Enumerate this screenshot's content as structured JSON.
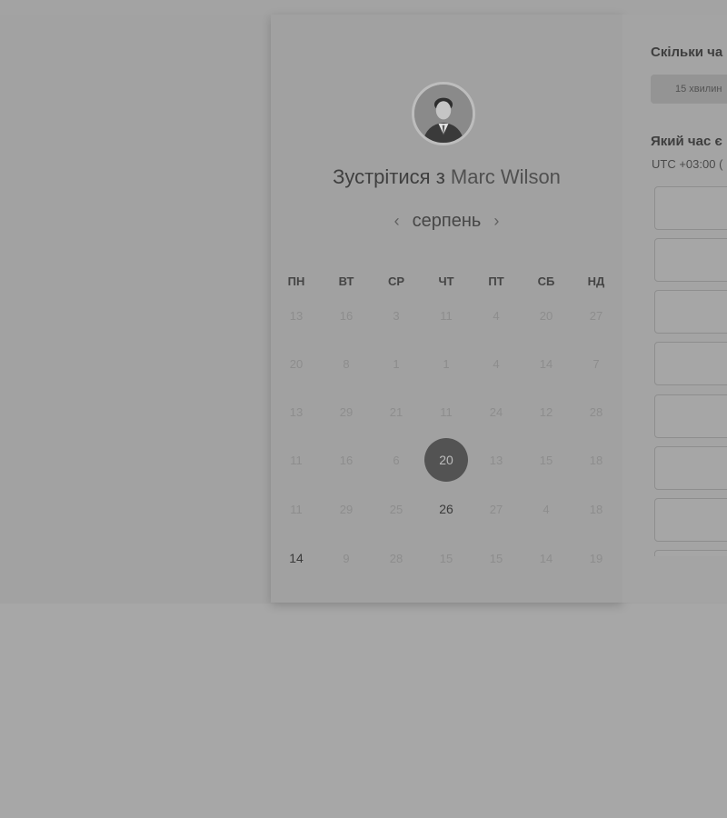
{
  "booking": {
    "title_prefix": "Зустрітися з ",
    "host_name": "Marc Wilson",
    "month": "серпень",
    "weekdays": [
      "ПН",
      "ВТ",
      "СР",
      "ЧТ",
      "ПТ",
      "СБ",
      "НД"
    ],
    "days": [
      [
        "13",
        "16",
        "3",
        "11",
        "4",
        "20",
        "27"
      ],
      [
        "20",
        "8",
        "1",
        "1",
        "4",
        "14",
        "7"
      ],
      [
        "13",
        "29",
        "21",
        "11",
        "24",
        "12",
        "28"
      ],
      [
        "11",
        "16",
        "6",
        "20",
        "13",
        "15",
        "18"
      ],
      [
        "11",
        "29",
        "25",
        "26",
        "27",
        "4",
        "18"
      ],
      [
        "14",
        "9",
        "28",
        "15",
        "15",
        "14",
        "19"
      ]
    ],
    "selected_day": "20",
    "available_days": [
      "26",
      "14"
    ]
  },
  "side": {
    "duration_heading": "Скільки ча",
    "duration_option": "15 хвилин",
    "time_heading": "Який час є",
    "timezone": "UTC +03:00 (",
    "time_slots": [
      "",
      "",
      "",
      "",
      "",
      "",
      "",
      ""
    ]
  },
  "icons": {
    "prev": "chevron-left-icon",
    "next": "chevron-right-icon"
  }
}
